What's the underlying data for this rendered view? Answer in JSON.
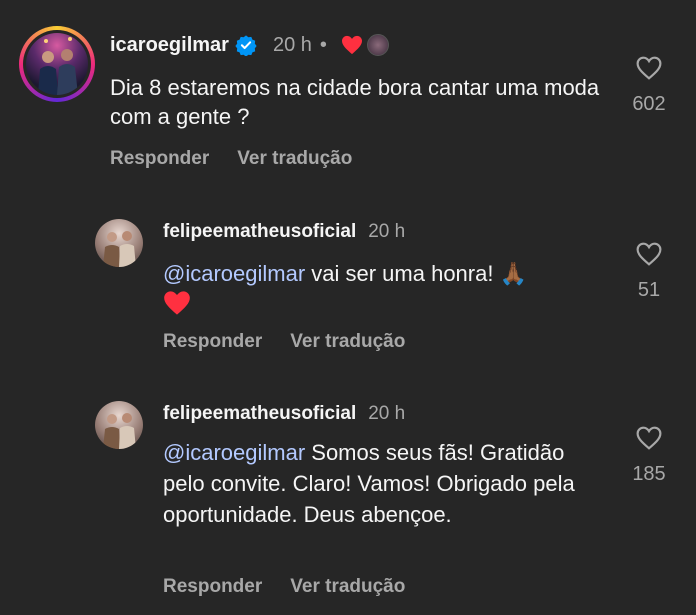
{
  "comments": [
    {
      "username": "icaroegilmar",
      "time": "20 h",
      "separator": "•",
      "text": "Dia 8 estaremos na cidade bora cantar uma moda com a gente ?",
      "reply_label": "Responder",
      "translate_label": "Ver tradução",
      "likes": "602",
      "verified": true
    },
    {
      "username": "felipeematheusoficial",
      "time": "20 h",
      "mention": "@icaroegilmar",
      "text": " vai ser uma honra! 🙏🏾",
      "reply_label": "Responder",
      "translate_label": "Ver tradução",
      "likes": "51"
    },
    {
      "username": "felipeematheusoficial",
      "time": "20 h",
      "mention": "@icaroegilmar",
      "text": " Somos seus fãs! Gratidão pelo convite. Claro! Vamos! Obrigado pela oportunidade. Deus abençoe.",
      "reply_label": "Responder",
      "translate_label": "Ver tradução",
      "likes": "185"
    }
  ],
  "colors": {
    "background": "#262626",
    "mention": "#b3c9ff",
    "verified": "#0095f6",
    "heart": "#ff3040",
    "muted": "#a8a8a8"
  }
}
